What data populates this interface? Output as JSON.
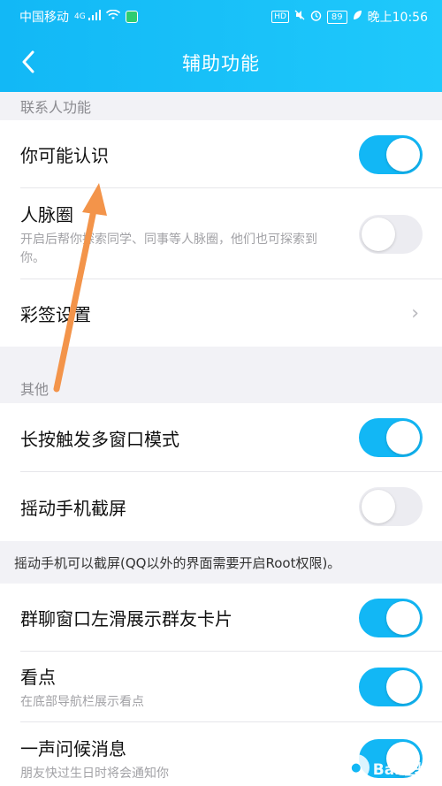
{
  "status_bar": {
    "carrier": "中国移动",
    "network": "4G",
    "hd": "HD",
    "battery": "89",
    "time": "晚上10:56"
  },
  "nav": {
    "title": "辅助功能",
    "back_icon": "chevron-left-icon"
  },
  "sections": {
    "contacts": {
      "header": "联系人功能",
      "items": [
        {
          "label": "你可能认识",
          "toggle": "on"
        },
        {
          "label": "人脉圈",
          "desc": "开启后帮你探索同学、同事等人脉圈，他们也可探索到你。",
          "toggle": "off"
        },
        {
          "label": "彩签设置",
          "chevron": "›"
        }
      ]
    },
    "other": {
      "header": "其他",
      "items": [
        {
          "label": "长按触发多窗口模式",
          "toggle": "on"
        },
        {
          "label": "摇动手机截屏",
          "toggle": "off"
        }
      ],
      "note": "摇动手机可以截屏(QQ以外的界面需要开启Root权限)。"
    },
    "group3": {
      "items": [
        {
          "label": "群聊窗口左滑展示群友卡片",
          "toggle": "on"
        },
        {
          "label": "看点",
          "desc": "在底部导航栏展示看点",
          "toggle": "on"
        },
        {
          "label": "一声问候消息",
          "desc": "朋友快过生日时将会通知你",
          "toggle": "on"
        }
      ]
    }
  },
  "watermark": {
    "text": "Bai经验",
    "icon": "paw-icon"
  },
  "colors": {
    "accent": "#12b7f5",
    "header_start": "#12b8f6",
    "header_end": "#1fc9fb",
    "annotation_arrow": "#f3944a"
  }
}
